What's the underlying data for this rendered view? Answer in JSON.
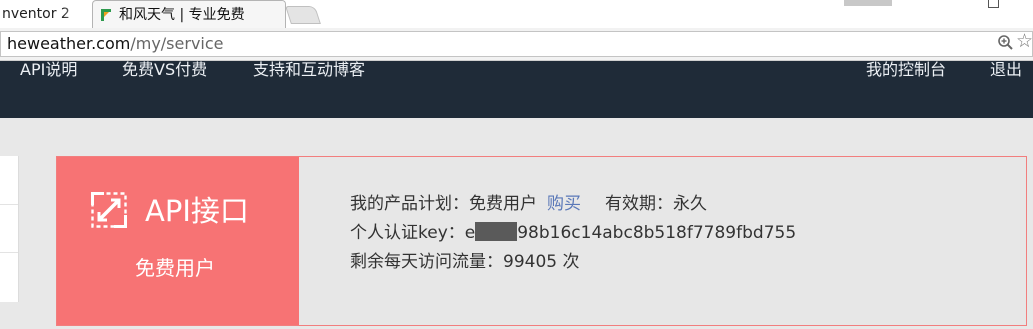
{
  "browser": {
    "tabs": [
      {
        "title": "nventor 2"
      },
      {
        "title": "和风天气 | 专业免费",
        "active": true
      }
    ],
    "url": {
      "host": "heweather.com",
      "path": "/my/service"
    }
  },
  "nav": {
    "items": [
      "API说明",
      "免费VS付费",
      "支持和互动博客"
    ],
    "right": [
      "我的控制台",
      "退出"
    ]
  },
  "card": {
    "title": "API接口",
    "subtitle": "免费用户",
    "plan_label": "我的产品计划：",
    "plan_value": "免费用户",
    "buy_label": "购买",
    "validity_label": "有效期：",
    "validity_value": "永久",
    "key_label": "个人认证key：",
    "key_prefix": "e",
    "key_suffix": "98b16c14abc8b518f7789fbd755",
    "traffic_label": "剩余每天访问流量：",
    "traffic_value": "99405",
    "traffic_unit": "次"
  },
  "icons": {
    "favicon": "heweather-favicon",
    "zoom": "zoom-icon",
    "bookmark": "star-icon",
    "api": "api-expand-icon"
  },
  "colors": {
    "nav_bg": "#1f2b38",
    "badge_bg": "#f77374",
    "link": "#5a78b8"
  }
}
